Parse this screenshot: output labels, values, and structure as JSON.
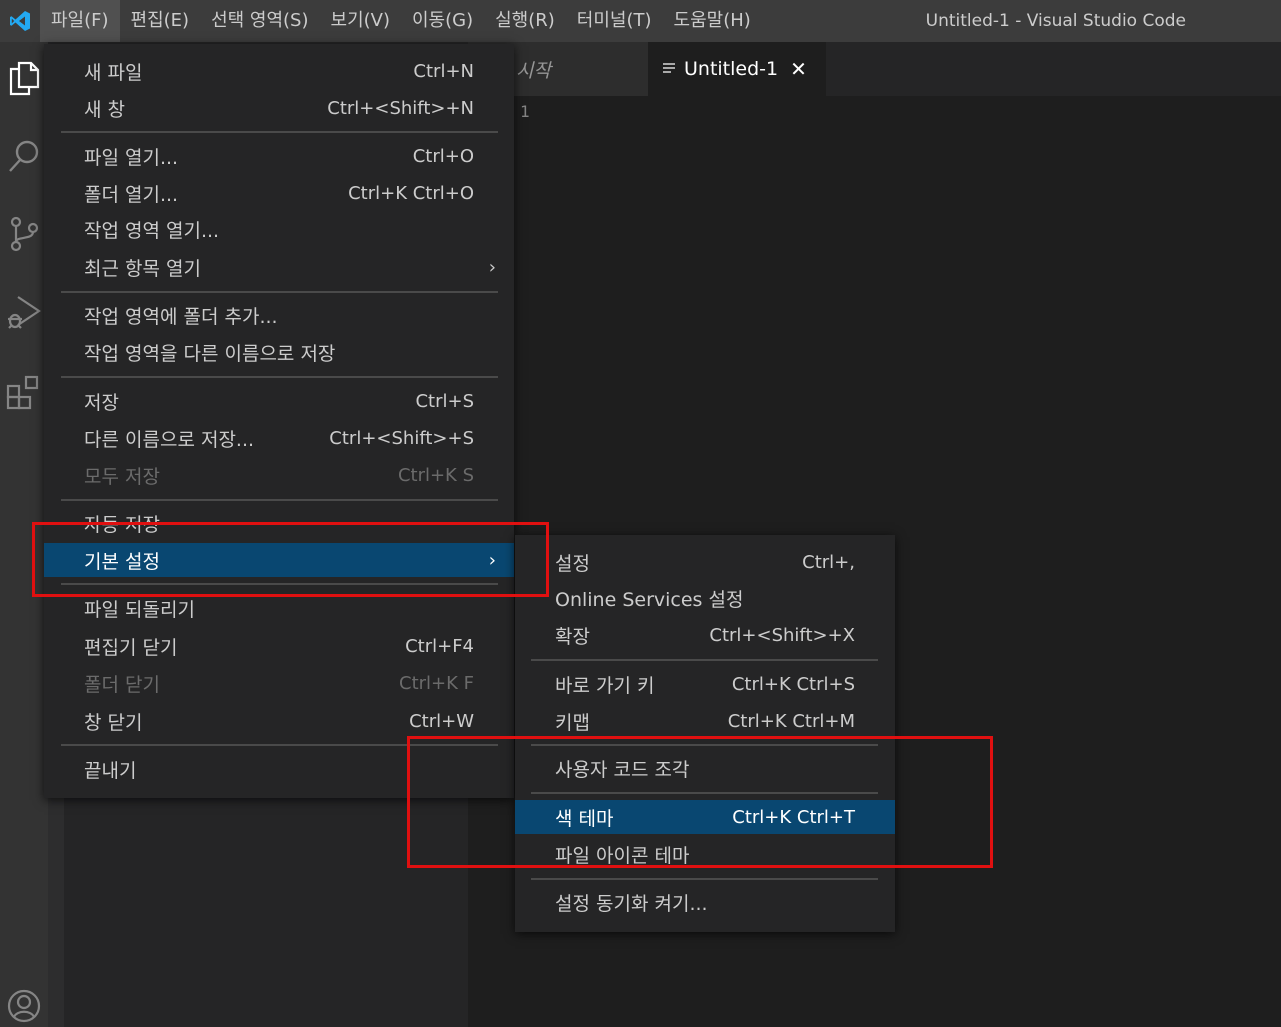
{
  "window": {
    "title": "Untitled-1 - Visual Studio Code"
  },
  "menubar": {
    "items": [
      "파일(F)",
      "편집(E)",
      "선택 영역(S)",
      "보기(V)",
      "이동(G)",
      "실행(R)",
      "터미널(T)",
      "도움말(H)"
    ]
  },
  "tabs": {
    "start_label": "시작",
    "active_label": "Untitled-1",
    "close_glyph": "✕"
  },
  "editor": {
    "line_number": "1"
  },
  "file_menu": {
    "items": [
      {
        "label": "새 파일",
        "key": "Ctrl+N"
      },
      {
        "label": "새 창",
        "key": "Ctrl+<Shift>+N"
      },
      {
        "label": "파일 열기...",
        "key": "Ctrl+O"
      },
      {
        "label": "폴더 열기...",
        "key": "Ctrl+K Ctrl+O"
      },
      {
        "label": "작업 영역 열기...",
        "key": ""
      },
      {
        "label": "최근 항목 열기",
        "key": "",
        "submenu": "›"
      },
      {
        "label": "작업 영역에 폴더 추가...",
        "key": ""
      },
      {
        "label": "작업 영역을 다른 이름으로 저장",
        "key": ""
      },
      {
        "label": "저장",
        "key": "Ctrl+S"
      },
      {
        "label": "다른 이름으로 저장...",
        "key": "Ctrl+<Shift>+S"
      },
      {
        "label": "모두 저장",
        "key": "Ctrl+K S",
        "disabled": true
      },
      {
        "label": "자동 저장",
        "key": ""
      },
      {
        "label": "기본 설정",
        "key": "",
        "submenu": "›",
        "selected": true
      },
      {
        "label": "파일 되돌리기",
        "key": ""
      },
      {
        "label": "편집기 닫기",
        "key": "Ctrl+F4"
      },
      {
        "label": "폴더 닫기",
        "key": "Ctrl+K F",
        "disabled": true
      },
      {
        "label": "창 닫기",
        "key": "Ctrl+W"
      },
      {
        "label": "끝내기",
        "key": ""
      }
    ]
  },
  "preferences_menu": {
    "items": [
      {
        "label": "설정",
        "key": "Ctrl+,"
      },
      {
        "label": "Online Services 설정",
        "key": ""
      },
      {
        "label": "확장",
        "key": "Ctrl+<Shift>+X"
      },
      {
        "label": "바로 가기 키",
        "key": "Ctrl+K Ctrl+S"
      },
      {
        "label": "키맵",
        "key": "Ctrl+K Ctrl+M"
      },
      {
        "label": "사용자 코드 조각",
        "key": ""
      },
      {
        "label": "색 테마",
        "key": "Ctrl+K Ctrl+T",
        "selected": true
      },
      {
        "label": "파일 아이콘 테마",
        "key": ""
      },
      {
        "label": "설정 동기화 켜기...",
        "key": ""
      }
    ]
  },
  "colors": {
    "accent": "#094771",
    "annotation": "#e01010",
    "logo": "#23a9f2"
  },
  "icons": [
    "vscode-logo-icon",
    "explorer-icon",
    "search-icon",
    "source-control-icon",
    "run-debug-icon",
    "extensions-icon",
    "account-icon"
  ]
}
